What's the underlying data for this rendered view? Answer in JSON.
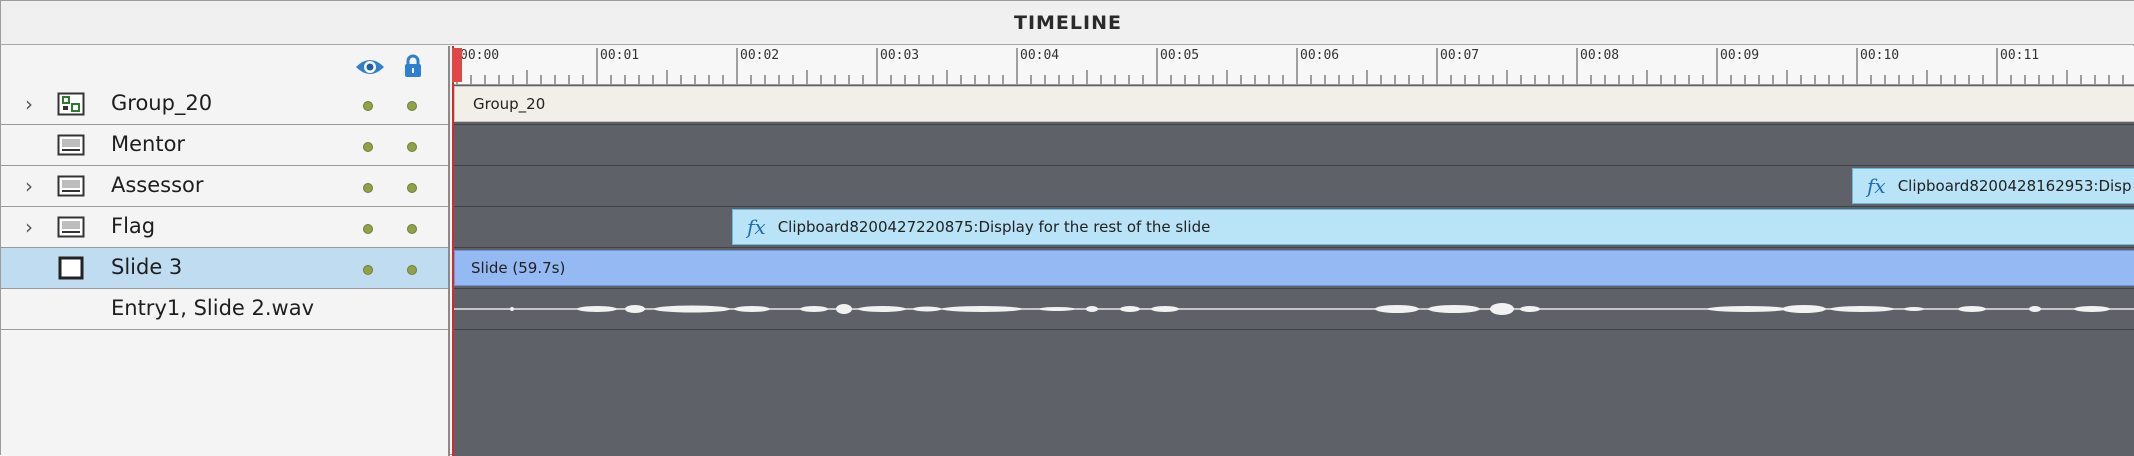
{
  "panel": {
    "title": "TIMELINE"
  },
  "header_icons": {
    "visibility": "eye-icon",
    "lock": "lock-icon"
  },
  "layers": [
    {
      "name": "Group_20",
      "icon": "group-object-icon",
      "expandable": true,
      "selected": false
    },
    {
      "name": "Mentor",
      "icon": "image-object-icon",
      "expandable": false,
      "selected": false
    },
    {
      "name": "Assessor",
      "icon": "image-object-icon",
      "expandable": true,
      "selected": false
    },
    {
      "name": "Flag",
      "icon": "image-object-icon",
      "expandable": true,
      "selected": false
    },
    {
      "name": "Slide 3",
      "icon": "slide-icon",
      "expandable": false,
      "selected": true
    },
    {
      "name": "Entry1, Slide 2.wav",
      "icon": "",
      "expandable": false,
      "selected": false
    }
  ],
  "ruler": {
    "labels": [
      "00:00",
      "00:01",
      "00:02",
      "00:03",
      "00:04",
      "00:05",
      "00:06",
      "00:07",
      "00:08",
      "00:09",
      "00:10",
      "00:11"
    ]
  },
  "tracks": {
    "group_bar": {
      "label": "Group_20"
    },
    "assessor_bar": {
      "label": "Clipboard8200428162953:Disp",
      "fx": "fx"
    },
    "flag_bar": {
      "label": "Clipboard8200427220875:Display for the rest  of the slide",
      "fx": "fx"
    },
    "slide_bar": {
      "label": "Slide (59.7s)"
    }
  },
  "colors": {
    "timeline_bg": "#5e6168",
    "selected_row": "#bfdcf1",
    "slide_bar": "#94b9f3",
    "effect_bar": "#b9e3f6",
    "playhead": "#d22d2d",
    "dot": "#8fa24a"
  }
}
